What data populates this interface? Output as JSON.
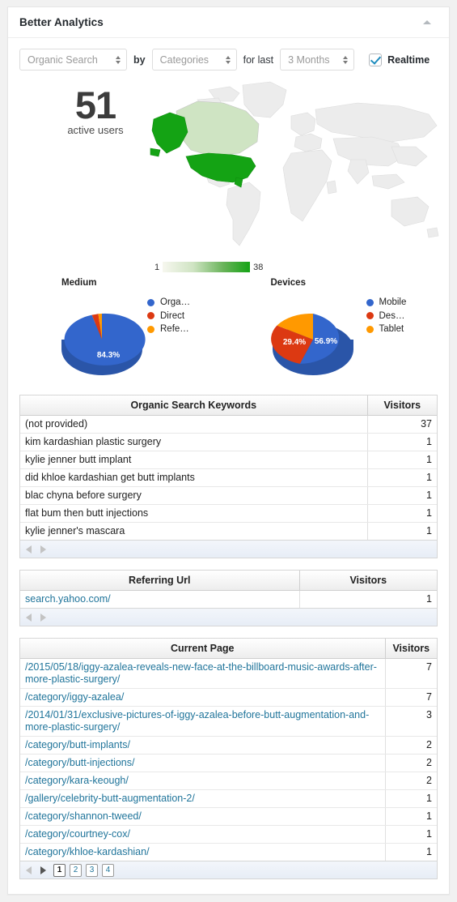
{
  "panel": {
    "title": "Better Analytics",
    "collapse_icon": "caret-up-icon"
  },
  "controls": {
    "source_select": {
      "value": "Organic Search",
      "icon": "updown-arrows-icon"
    },
    "by_label": "by",
    "dimension_select": {
      "value": "Categories",
      "icon": "updown-arrows-icon"
    },
    "forlast_label": "for last",
    "period_select": {
      "value": "3 Months",
      "icon": "updown-arrows-icon"
    },
    "realtime": {
      "label": "Realtime",
      "checked": true,
      "icon": "checkbox-checked-icon"
    }
  },
  "stats": {
    "active_users_value": "51",
    "active_users_caption": "active users"
  },
  "chart_data": [
    {
      "type": "heatmap",
      "subtype": "geo-map",
      "title": "Active users by country",
      "legend_min": "1",
      "legend_max": "38",
      "legend_position": "bottom-left",
      "color_scale": [
        "#f7f7ef",
        "#14a314"
      ],
      "regions": [
        {
          "name": "United States",
          "value": 38,
          "color": "#14a314"
        },
        {
          "name": "Canada",
          "value": 4,
          "color": "#cfe4c3"
        }
      ]
    },
    {
      "type": "pie",
      "title": "Medium",
      "legend_position": "right",
      "labels": [
        "Orga…",
        "Direct",
        "Refe…"
      ],
      "full_labels": [
        "Organic Search",
        "Direct",
        "Referral"
      ],
      "values": [
        84.3,
        13.7,
        2.0
      ],
      "slice_labels": [
        "84.3%",
        "",
        ""
      ],
      "colors": [
        "#3366cc",
        "#dc3912",
        "#ff9900"
      ]
    },
    {
      "type": "pie",
      "title": "Devices",
      "legend_position": "right",
      "labels": [
        "Mobile",
        "Des…",
        "Tablet"
      ],
      "full_labels": [
        "Mobile",
        "Desktop",
        "Tablet"
      ],
      "values": [
        56.9,
        29.4,
        13.7
      ],
      "slice_labels": [
        "56.9%",
        "29.4%",
        ""
      ],
      "colors": [
        "#3366cc",
        "#dc3912",
        "#ff9900"
      ]
    }
  ],
  "keywords_table": {
    "columns": [
      "Organic Search Keywords",
      "Visitors"
    ],
    "rows": [
      {
        "label": "(not provided)",
        "visitors": "37",
        "link": false
      },
      {
        "label": "kim kardashian plastic surgery",
        "visitors": "1",
        "link": false
      },
      {
        "label": "kylie jenner butt implant",
        "visitors": "1",
        "link": false
      },
      {
        "label": "did khloe kardashian get butt implants",
        "visitors": "1",
        "link": false
      },
      {
        "label": "blac chyna before surgery",
        "visitors": "1",
        "link": false
      },
      {
        "label": "flat bum then butt injections",
        "visitors": "1",
        "link": false
      },
      {
        "label": "kylie jenner's mascara",
        "visitors": "1",
        "link": false
      }
    ],
    "pager": {
      "prev_icon": "triangle-left-icon",
      "next_icon": "triangle-right-icon",
      "pages": []
    }
  },
  "referrers_table": {
    "columns": [
      "Referring Url",
      "Visitors"
    ],
    "rows": [
      {
        "label": "search.yahoo.com/",
        "visitors": "1",
        "link": true
      }
    ],
    "pager": {
      "prev_icon": "triangle-left-icon",
      "next_icon": "triangle-right-icon",
      "pages": []
    }
  },
  "pages_table": {
    "columns": [
      "Current Page",
      "Visitors"
    ],
    "rows": [
      {
        "label": "/2015/05/18/iggy-azalea-reveals-new-face-at-the-billboard-music-awards-after-more-plastic-surgery/",
        "visitors": "7",
        "link": true
      },
      {
        "label": "/category/iggy-azalea/",
        "visitors": "7",
        "link": true
      },
      {
        "label": "/2014/01/31/exclusive-pictures-of-iggy-azalea-before-butt-augmentation-and-more-plastic-surgery/",
        "visitors": "3",
        "link": true
      },
      {
        "label": "/category/butt-implants/",
        "visitors": "2",
        "link": true
      },
      {
        "label": "/category/butt-injections/",
        "visitors": "2",
        "link": true
      },
      {
        "label": "/category/kara-keough/",
        "visitors": "2",
        "link": true
      },
      {
        "label": "/gallery/celebrity-butt-augmentation-2/",
        "visitors": "1",
        "link": true
      },
      {
        "label": "/category/shannon-tweed/",
        "visitors": "1",
        "link": true
      },
      {
        "label": "/category/courtney-cox/",
        "visitors": "1",
        "link": true
      },
      {
        "label": "/category/khloe-kardashian/",
        "visitors": "1",
        "link": true
      }
    ],
    "pager": {
      "prev_icon": "triangle-left-icon",
      "next_icon": "triangle-right-icon",
      "pages": [
        "1",
        "2",
        "3",
        "4"
      ],
      "active_page": "1"
    }
  },
  "colors": {
    "accent_link": "#21759b",
    "map_green": "#14a314",
    "pie_blue": "#3366cc",
    "pie_red": "#dc3912",
    "pie_orange": "#ff9900"
  }
}
